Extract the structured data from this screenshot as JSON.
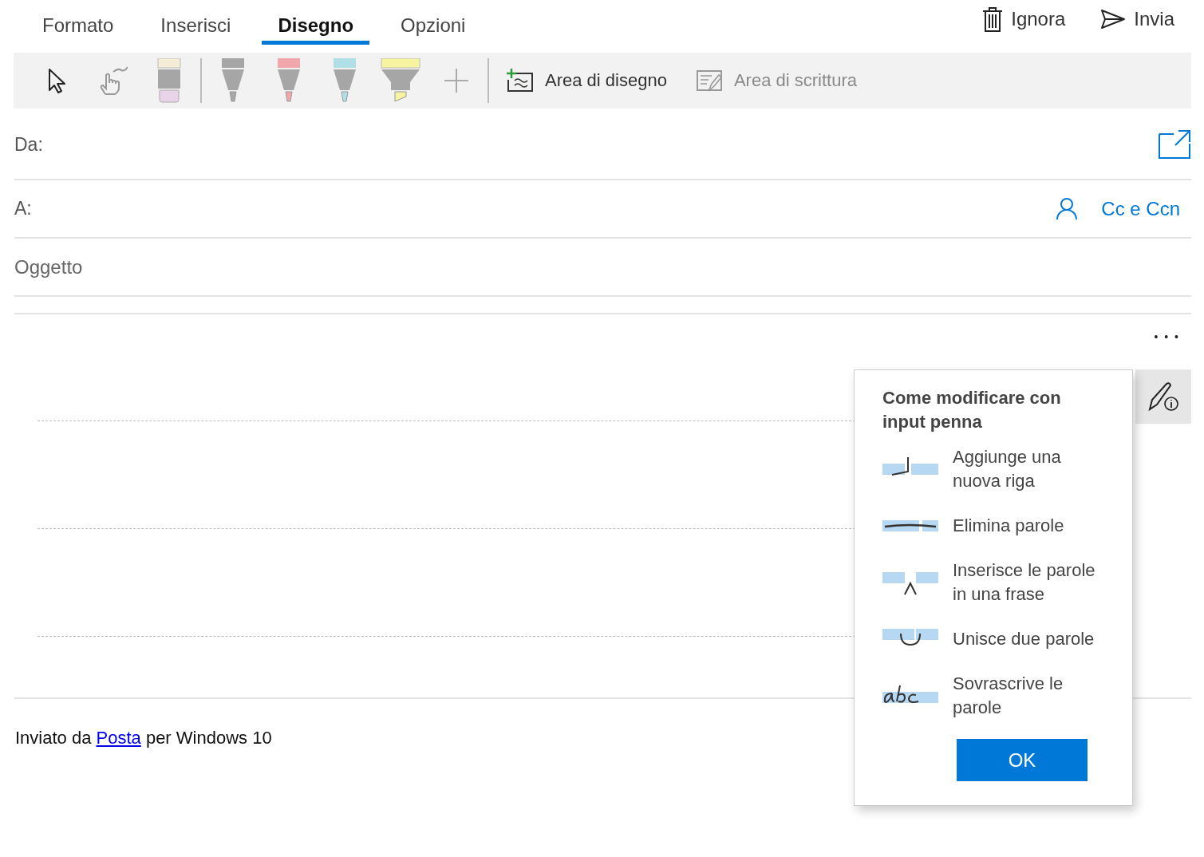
{
  "tabs": [
    {
      "label": "Formato",
      "selected": false
    },
    {
      "label": "Inserisci",
      "selected": false
    },
    {
      "label": "Disegno",
      "selected": true
    },
    {
      "label": "Opzioni",
      "selected": false
    }
  ],
  "actions": [
    {
      "kind": "discard",
      "label": "Ignora"
    },
    {
      "kind": "send",
      "label": "Invia"
    }
  ],
  "toolbar": {
    "tools": [
      {
        "kind": "select"
      },
      {
        "kind": "touch"
      },
      {
        "kind": "eraser",
        "color": "#e8d3e8"
      },
      {
        "kind": "pen",
        "color": "#a6a6a6"
      },
      {
        "kind": "pen",
        "color": "#f0a8ad"
      },
      {
        "kind": "pen",
        "color": "#b0e0e6"
      },
      {
        "kind": "highlighter",
        "color": "#f7f3a0"
      },
      {
        "kind": "add"
      }
    ],
    "buttons": [
      {
        "kind": "drawing",
        "label": "Area di disegno",
        "disabled": false
      },
      {
        "kind": "writing",
        "label": "Area di scrittura",
        "disabled": true
      }
    ]
  },
  "from": {
    "label": "Da:"
  },
  "to": {
    "label": "A:",
    "cc_link": "Cc e Ccn"
  },
  "subject": {
    "placeholder": "Oggetto"
  },
  "body": {
    "more": "• • •",
    "signature": {
      "before": "Inviato da ",
      "link": "Posta",
      "after": " per Windows 10"
    }
  },
  "popup": {
    "title": "Come modificare con input penna",
    "items": [
      {
        "kind": "newline",
        "text": "Aggiunge una nuova riga"
      },
      {
        "kind": "delete",
        "text": "Elimina parole"
      },
      {
        "kind": "insert",
        "text": "Inserisce le parole in una frase"
      },
      {
        "kind": "join",
        "text": "Unisce due parole"
      },
      {
        "kind": "overwrite",
        "text": "Sovrascrive le parole"
      }
    ],
    "ok": "OK"
  }
}
